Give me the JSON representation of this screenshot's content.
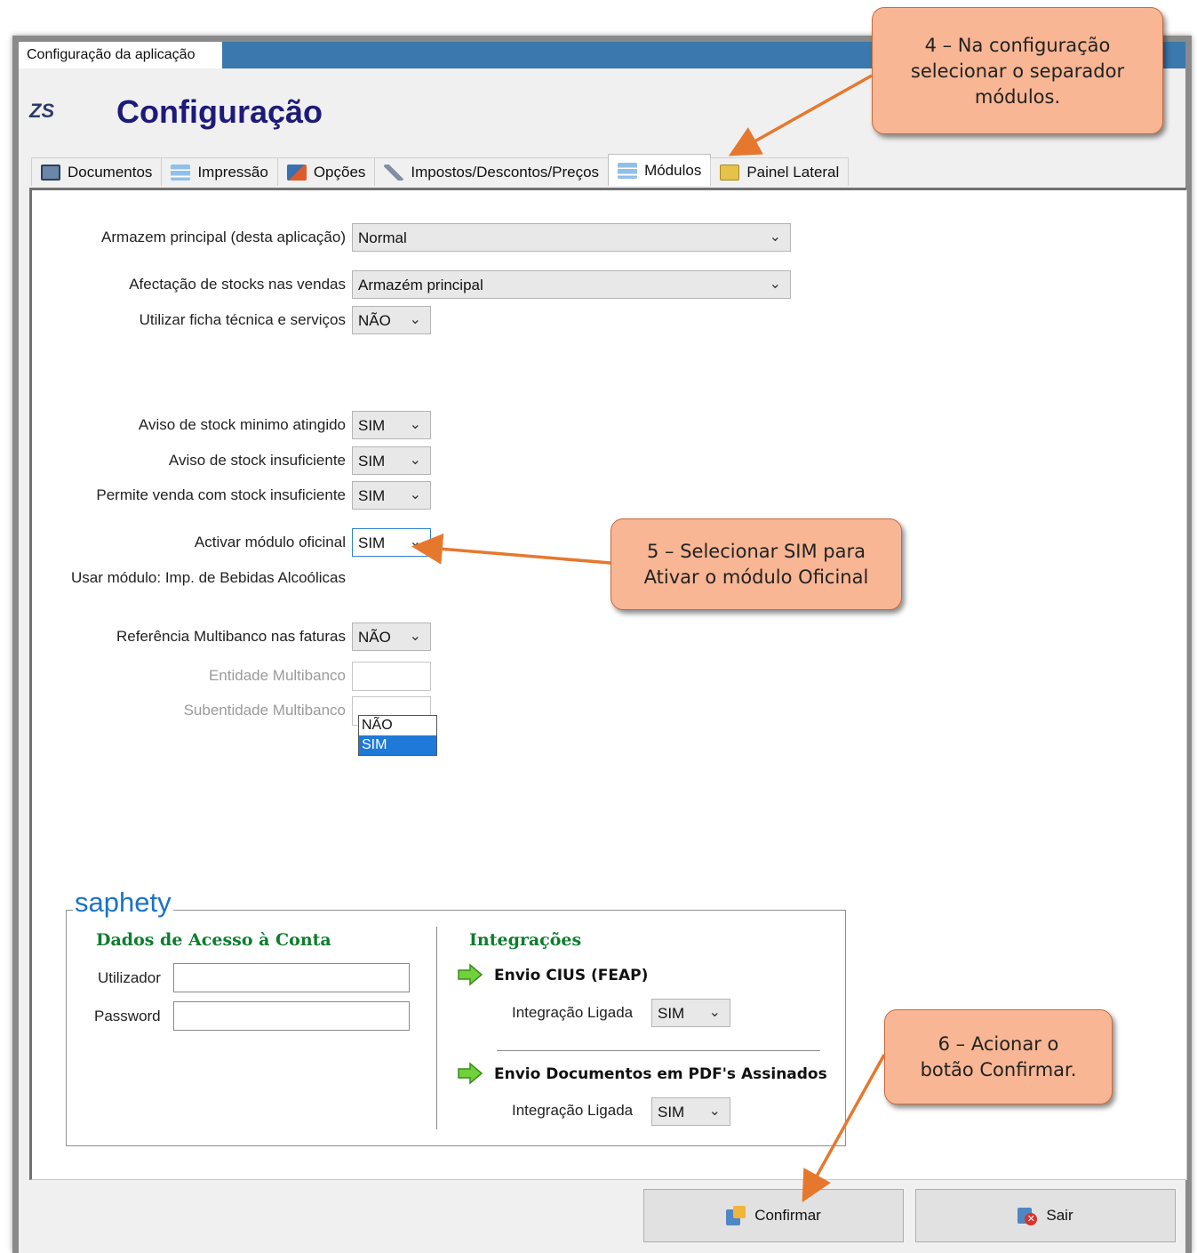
{
  "window": {
    "title": "Configuração da aplicação",
    "logo": "ZS",
    "heading": "Configuração"
  },
  "tabs": [
    {
      "label": "Documentos",
      "icon": "documents-icon"
    },
    {
      "label": "Impressão",
      "icon": "print-list-icon"
    },
    {
      "label": "Opções",
      "icon": "options-icon"
    },
    {
      "label": "Impostos/Descontos/Preços",
      "icon": "pen-icon"
    },
    {
      "label": "Módulos",
      "icon": "modules-list-icon",
      "active": true
    },
    {
      "label": "Painel Lateral",
      "icon": "side-panel-icon"
    }
  ],
  "fields": {
    "armazem": {
      "label": "Armazem principal (desta aplicação)",
      "value": "Normal"
    },
    "afectacao": {
      "label": "Afectação de stocks nas vendas",
      "value": "Armazém principal"
    },
    "ficha": {
      "label": "Utilizar ficha técnica e serviços",
      "value": "NÃO"
    },
    "aviso_min": {
      "label": "Aviso de stock minimo atingido",
      "value": "SIM"
    },
    "aviso_insuf": {
      "label": "Aviso de stock insuficiente",
      "value": "SIM"
    },
    "venda_insuf": {
      "label": "Permite venda com  stock insuficiente",
      "value": "SIM"
    },
    "oficinal": {
      "label": "Activar módulo oficinal",
      "value": "SIM",
      "options": [
        "NÃO",
        "SIM"
      ]
    },
    "bebidas": {
      "label": "Usar módulo: Imp. de Bebidas Alcoólicas"
    },
    "multibanco": {
      "label": "Referência Multibanco nas faturas",
      "value": "NÃO"
    },
    "entidade": {
      "label": "Entidade Multibanco"
    },
    "subentidade": {
      "label": "Subentidade Multibanco"
    }
  },
  "saphety": {
    "logo": "saphety",
    "access_title": "Dados de Acesso à Conta",
    "user_label": "Utilizador",
    "password_label": "Password",
    "integrations_title": "Integrações",
    "cius_title": "Envio CIUS (FEAP)",
    "cius_label": "Integração Ligada",
    "cius_value": "SIM",
    "pdf_title": "Envio Documentos em PDF's Assinados",
    "pdf_label": "Integração Ligada",
    "pdf_value": "SIM"
  },
  "buttons": {
    "confirm": "Confirmar",
    "exit": "Sair"
  },
  "callouts": {
    "step4": [
      "4 – Na configuração",
      "selecionar o separador",
      "módulos."
    ],
    "step5": [
      "5 – Selecionar SIM para",
      "Ativar o módulo Oficinal"
    ],
    "step6": [
      "6 – Acionar o",
      "botão Confirmar."
    ]
  },
  "colors": {
    "titlebar": "#3b78ad",
    "heading": "#1e1a7a",
    "section_green": "#0d7d2d",
    "saphety_blue": "#1b72c9",
    "callout_fill": "#f8b694",
    "arrow": "#e6782e",
    "selection": "#1e7ad6"
  }
}
